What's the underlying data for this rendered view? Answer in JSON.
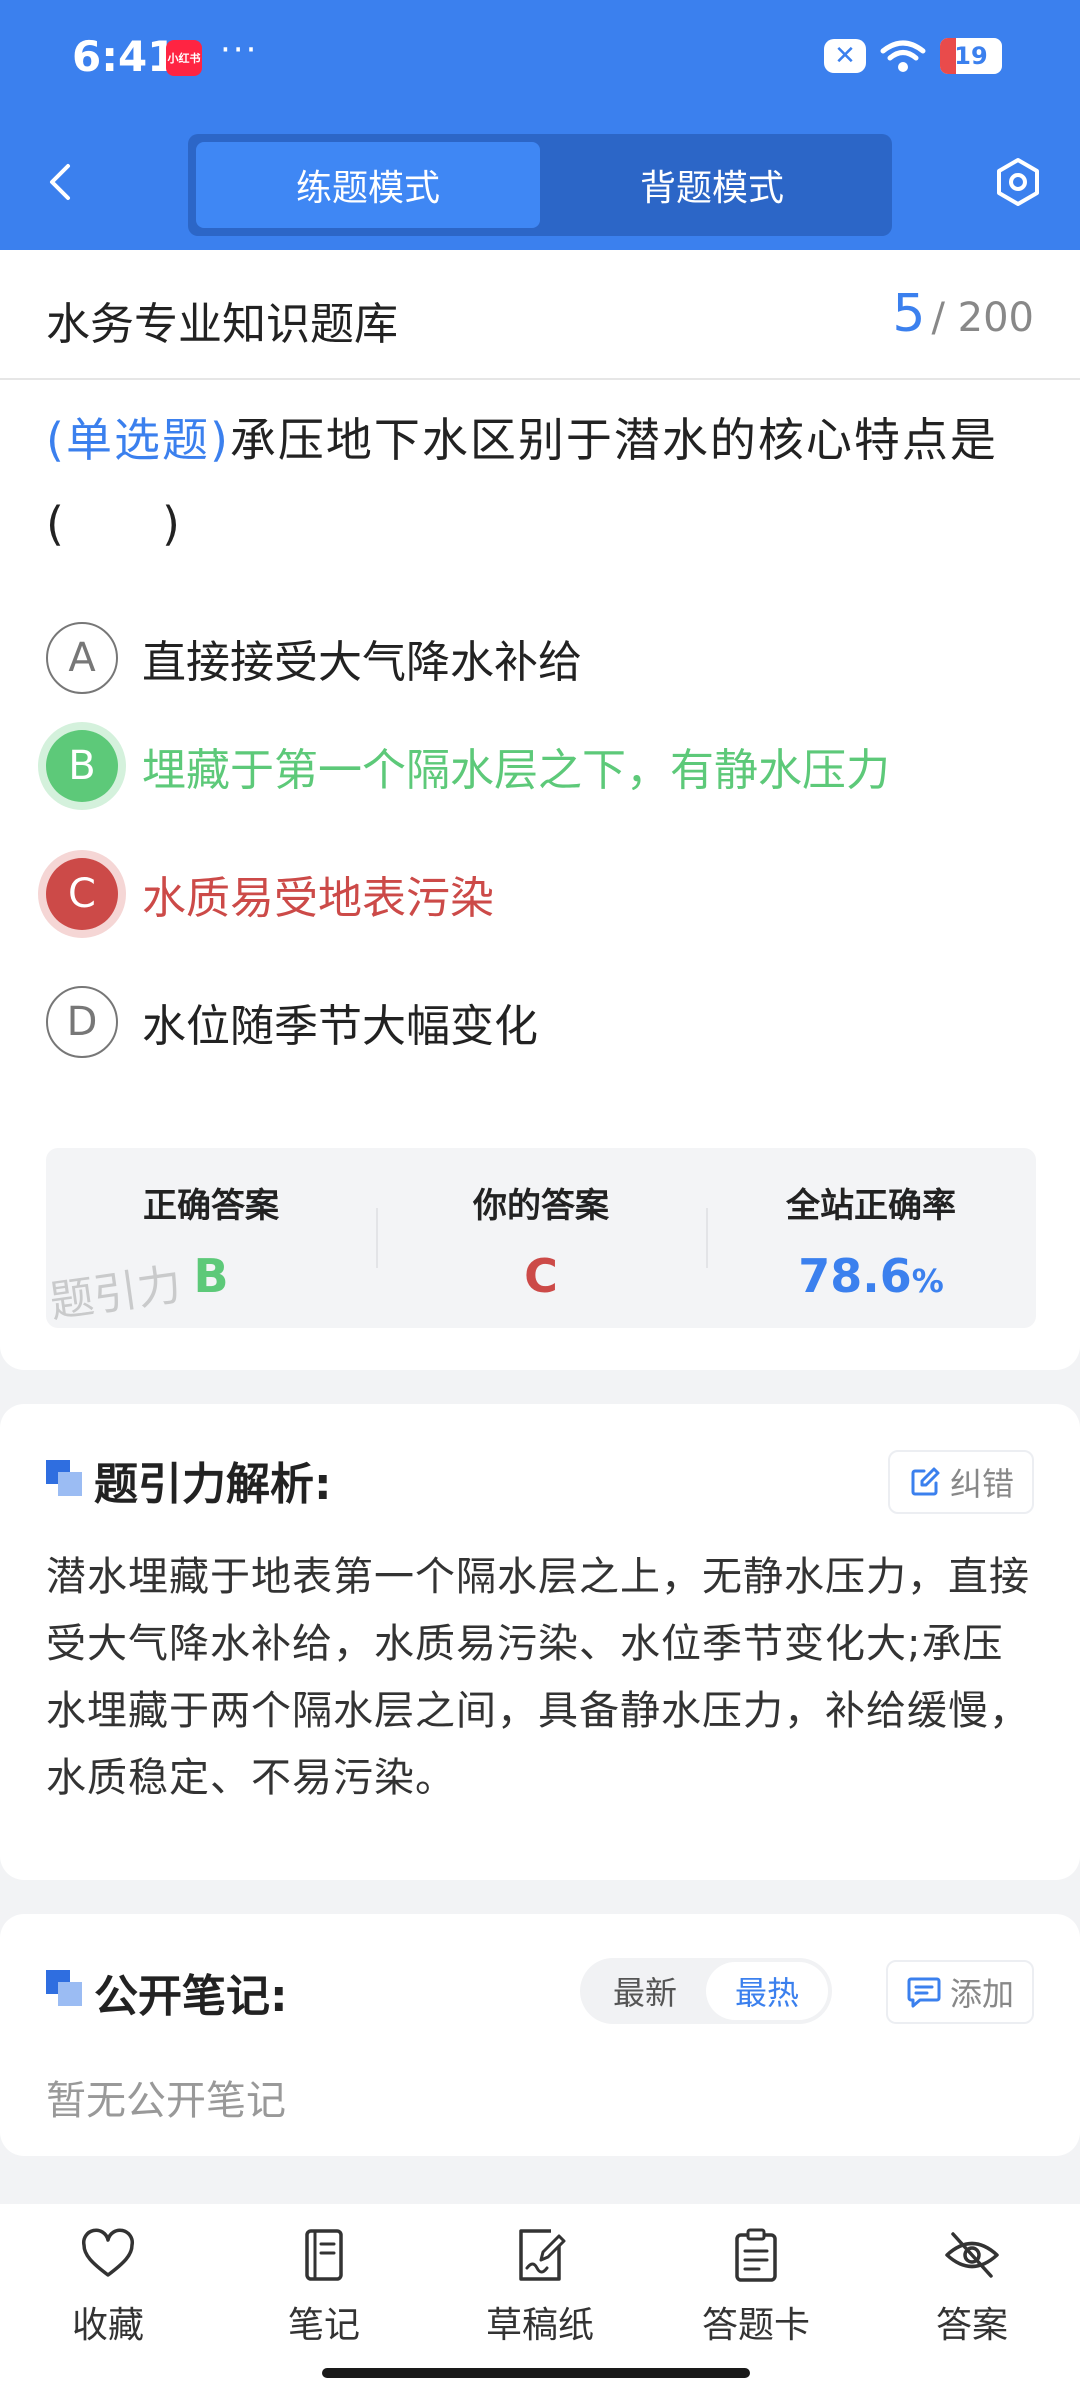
{
  "status_bar": {
    "time": "6:41",
    "app_badge": "小红书",
    "more_dots": "···",
    "battery_level": "19",
    "icons": [
      "notification-app-icon",
      "x-icon",
      "wifi-icon",
      "battery-icon"
    ]
  },
  "header": {
    "tabs": [
      {
        "label": "练题模式",
        "active": true
      },
      {
        "label": "背题模式",
        "active": false
      }
    ],
    "icons": {
      "back": "chevron-left-icon",
      "settings": "hexagon-settings-icon"
    }
  },
  "bank": {
    "title": "水务专业知识题库",
    "current": "5",
    "total": "/ 200"
  },
  "question": {
    "type": "(单选题)",
    "stem": "承压地下水区别于潜水的核心特点是 (　　)",
    "options": [
      {
        "key": "A",
        "text": "直接接受大气降水补给",
        "state": "normal"
      },
      {
        "key": "B",
        "text": "埋藏于第一个隔水层之下，有静水压力",
        "state": "correct"
      },
      {
        "key": "C",
        "text": "水质易受地表污染",
        "state": "wrong"
      },
      {
        "key": "D",
        "text": "水位随季节大幅变化",
        "state": "normal"
      }
    ]
  },
  "result": {
    "correct_label": "正确答案",
    "correct_value": "B",
    "mine_label": "你的答案",
    "mine_value": "C",
    "rate_label": "全站正确率",
    "rate_value": "78.6",
    "rate_unit": "%",
    "watermark": "题引力"
  },
  "analysis": {
    "title": "题引力解析:",
    "report_label": "纠错",
    "text": "潜水埋藏于地表第一个隔水层之上，无静水压力，直接受大气降水补给，水质易污染、水位季节变化大;承压水埋藏于两个隔水层之间，具备静水压力，补给缓慢，水质稳定、不易污染。"
  },
  "notes": {
    "title": "公开笔记:",
    "sort_options": [
      {
        "label": "最新",
        "active": false
      },
      {
        "label": "最热",
        "active": true
      }
    ],
    "add_label": "添加",
    "empty_text": "暂无公开笔记"
  },
  "bottom_nav": [
    {
      "label": "收藏",
      "icon": "heart-icon"
    },
    {
      "label": "笔记",
      "icon": "notebook-icon"
    },
    {
      "label": "草稿纸",
      "icon": "draft-paper-icon"
    },
    {
      "label": "答题卡",
      "icon": "answer-sheet-icon"
    },
    {
      "label": "答案",
      "icon": "eye-off-icon"
    }
  ],
  "colors": {
    "primary": "#3b80ee",
    "correct": "#5dc979",
    "wrong": "#cc4a48"
  }
}
